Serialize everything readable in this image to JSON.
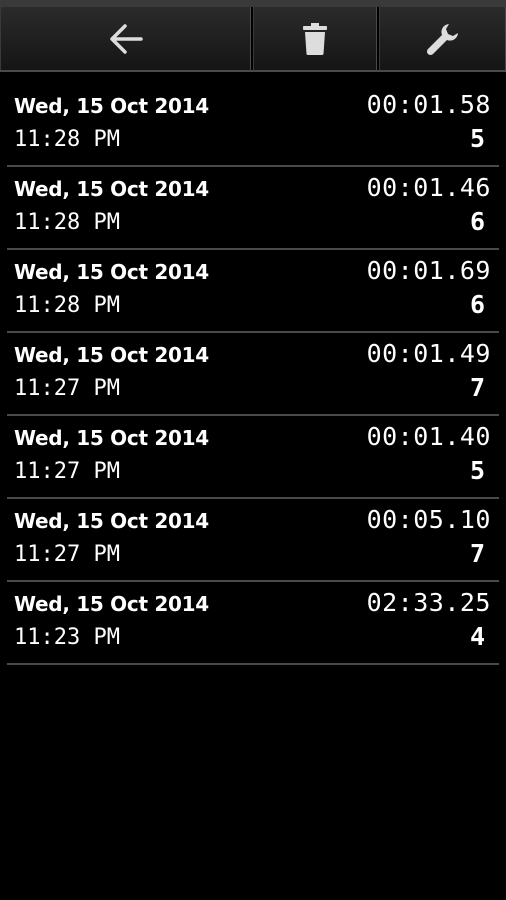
{
  "toolbar": {
    "back_icon": "arrow-left-icon",
    "delete_icon": "trash-icon",
    "settings_icon": "wrench-icon"
  },
  "records": [
    {
      "date": "Wed, 15 Oct 2014",
      "time": "11:28 PM",
      "duration": "00:01.58",
      "count": "5"
    },
    {
      "date": "Wed, 15 Oct 2014",
      "time": "11:28 PM",
      "duration": "00:01.46",
      "count": "6"
    },
    {
      "date": "Wed, 15 Oct 2014",
      "time": "11:28 PM",
      "duration": "00:01.69",
      "count": "6"
    },
    {
      "date": "Wed, 15 Oct 2014",
      "time": "11:27 PM",
      "duration": "00:01.49",
      "count": "7"
    },
    {
      "date": "Wed, 15 Oct 2014",
      "time": "11:27 PM",
      "duration": "00:01.40",
      "count": "5"
    },
    {
      "date": "Wed, 15 Oct 2014",
      "time": "11:27 PM",
      "duration": "00:05.10",
      "count": "7"
    },
    {
      "date": "Wed, 15 Oct 2014",
      "time": "11:23 PM",
      "duration": "02:33.25",
      "count": "4"
    }
  ],
  "colors": {
    "background": "#000000",
    "text": "#ffffff",
    "divider": "#4a4a4a",
    "icon": "#dddddd"
  }
}
